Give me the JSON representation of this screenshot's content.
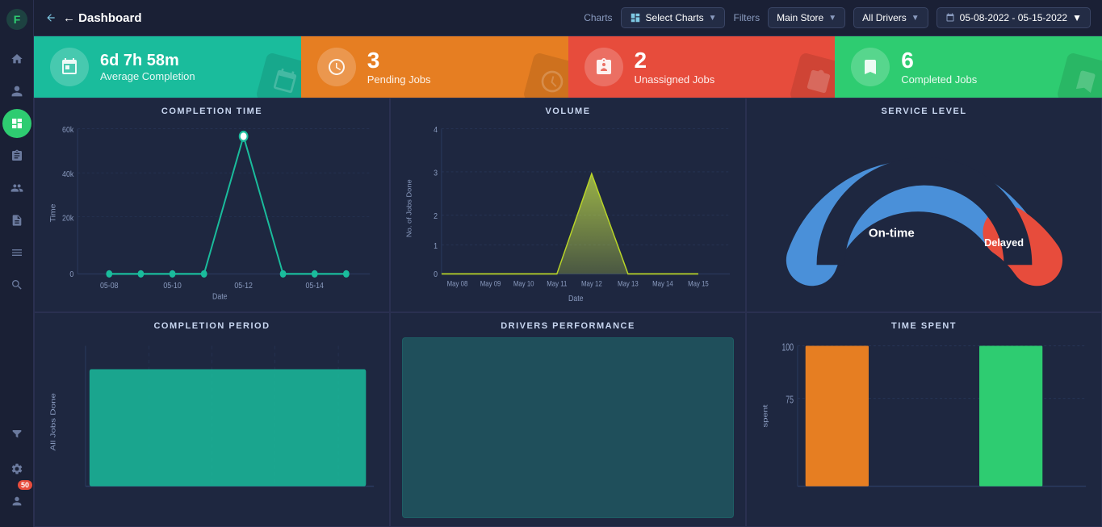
{
  "sidebar": {
    "icons": [
      {
        "name": "home-icon",
        "symbol": "⌂",
        "active": false
      },
      {
        "name": "users-icon",
        "symbol": "👤",
        "active": false
      },
      {
        "name": "dashboard-icon",
        "symbol": "◉",
        "active": true
      },
      {
        "name": "clipboard-icon",
        "symbol": "📋",
        "active": false
      },
      {
        "name": "team-icon",
        "symbol": "👥",
        "active": false
      },
      {
        "name": "reports-icon",
        "symbol": "📊",
        "active": false
      },
      {
        "name": "list-icon",
        "symbol": "☰",
        "active": false
      },
      {
        "name": "search-icon",
        "symbol": "🔍",
        "active": false
      },
      {
        "name": "filter-icon",
        "symbol": "⚡",
        "active": false
      }
    ],
    "bottom_icons": [
      {
        "name": "settings-icon",
        "symbol": "⚙",
        "active": false
      },
      {
        "name": "profile-icon",
        "symbol": "👤",
        "active": false
      }
    ],
    "badge": "50"
  },
  "header": {
    "back_label": "← Dashboard",
    "filters_label": "Filters",
    "charts_label": "Charts",
    "select_charts": "Select Charts",
    "store": "Main Store",
    "drivers": "All Drivers",
    "date_range": "05-08-2022 - 05-15-2022"
  },
  "stats": [
    {
      "id": "avg-completion",
      "color": "teal",
      "number": "6d 7h 58m",
      "label": "Average Completion",
      "icon": "📅"
    },
    {
      "id": "pending-jobs",
      "color": "orange",
      "number": "3",
      "label": "Pending Jobs",
      "icon": "⏱"
    },
    {
      "id": "unassigned-jobs",
      "color": "red",
      "number": "2",
      "label": "Unassigned Jobs",
      "icon": "📋"
    },
    {
      "id": "completed-jobs",
      "color": "green",
      "number": "6",
      "label": "Completed Jobs",
      "icon": "💾"
    }
  ],
  "charts": {
    "completion_time": {
      "title": "COMPLETION TIME",
      "x_label": "Date",
      "y_label": "Time",
      "y_ticks": [
        "0",
        "20k",
        "40k",
        "60k"
      ],
      "x_ticks": [
        "05-08",
        "05-10",
        "05-12",
        "05-14"
      ]
    },
    "volume": {
      "title": "VOLUME",
      "x_label": "Date",
      "y_label": "No. of Jobs Done",
      "y_ticks": [
        "0",
        "1",
        "2",
        "3",
        "4"
      ],
      "x_ticks": [
        "May 08",
        "May 09",
        "May 10",
        "May 11",
        "May 12",
        "May 13",
        "May 14",
        "May 15"
      ]
    },
    "service_level": {
      "title": "SERVICE LEVEL",
      "on_time_label": "On-time",
      "delayed_label": "Delayed"
    },
    "completion_period": {
      "title": "COMPLETION PERIOD",
      "y_label": "All Jobs Done"
    },
    "drivers_performance": {
      "title": "DRIVERS PERFORMANCE"
    },
    "time_spent": {
      "title": "TIME SPENT",
      "y_label": "spent",
      "y_ticks": [
        "75",
        "100"
      ]
    }
  }
}
